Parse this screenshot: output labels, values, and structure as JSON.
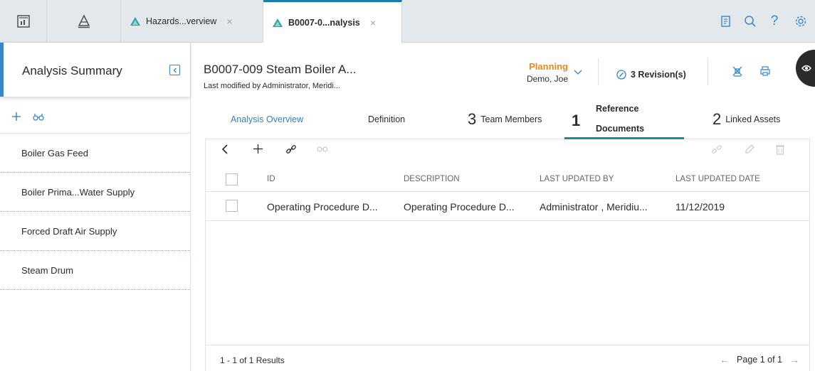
{
  "tabs": {
    "doc_tabs": [
      {
        "label": "Hazards...verview",
        "close": "×"
      },
      {
        "label": "B0007-0...nalysis",
        "close": "×"
      }
    ]
  },
  "sidebar": {
    "title": "Analysis Summary",
    "items": [
      {
        "label": "Boiler Gas Feed"
      },
      {
        "label": "Boiler Prima...Water Supply"
      },
      {
        "label": "Forced Draft Air Supply"
      },
      {
        "label": "Steam Drum"
      }
    ]
  },
  "record": {
    "title": "B0007-009 Steam Boiler A...",
    "subtitle": "Last modified by Administrator, Meridi...",
    "status": "Planning",
    "status_user": "Demo, Joe",
    "revisions": "3 Revision(s)"
  },
  "subtabs": {
    "overview": "Analysis Overview",
    "definition": "Definition",
    "team_count": "3",
    "team_label": "Team Members",
    "ref_count": "1",
    "ref_label_1": "Reference",
    "ref_label_2": "Documents",
    "assets_count": "2",
    "assets_label": "Linked Assets"
  },
  "grid": {
    "columns": [
      "ID",
      "DESCRIPTION",
      "LAST UPDATED BY",
      "LAST UPDATED DATE"
    ],
    "rows": [
      {
        "id": "Operating Procedure D...",
        "description": "Operating Procedure D...",
        "updated_by": "Administrator , Meridiu...",
        "updated_date": "11/12/2019"
      }
    ],
    "results": "1 - 1 of 1 Results",
    "page": "Page 1 of 1",
    "prev": "←",
    "next": "→"
  },
  "colors": {
    "accent": "#1a7fa8",
    "status": "#f0891a",
    "link": "#2f7fc1",
    "active_tab_underline": "#1a8a9c"
  },
  "icons": [
    "dashboard-icon",
    "hazards-icon",
    "triangle-icon",
    "report-icon",
    "search-icon",
    "help-icon",
    "settings-icon",
    "collapse-icon",
    "add-icon",
    "binoculars-icon",
    "chevron-down-icon",
    "revision-icon",
    "network-icon",
    "print-icon",
    "back-icon",
    "link-icon",
    "unlink-icon",
    "edit-icon",
    "delete-icon"
  ]
}
